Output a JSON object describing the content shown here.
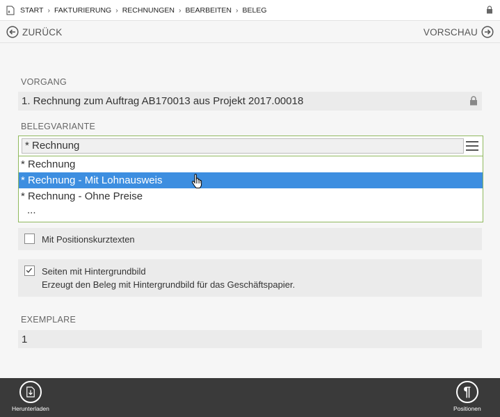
{
  "breadcrumb": {
    "items": [
      "START",
      "FAKTURIERUNG",
      "RECHNUNGEN",
      "BEARBEITEN",
      "BELEG"
    ],
    "separator": "›"
  },
  "nav": {
    "back_label": "ZURÜCK",
    "preview_label": "VORSCHAU"
  },
  "vorgang": {
    "label": "VORGANG",
    "value": "1. Rechnung zum Auftrag AB170013 aus Projekt 2017.00018",
    "locked": true
  },
  "belegvariante": {
    "label": "BELEGVARIANTE",
    "value": "* Rechnung",
    "options": [
      "* Rechnung",
      "* Rechnung - Mit Lohnausweis",
      "* Rechnung - Ohne Preise",
      "..."
    ],
    "highlighted_index": 1
  },
  "options": {
    "positionskurztexte_label": "Mit Positionskurztexten",
    "positionskurztexte_checked": false,
    "hintergrundbild_label": "Seiten mit Hintergrundbild",
    "hintergrundbild_desc": "Erzeugt den Beleg mit Hintergrundbild für das Geschäftspapier.",
    "hintergrundbild_checked": true
  },
  "exemplare": {
    "label": "EXEMPLARE",
    "value": "1"
  },
  "bottom": {
    "download_label": "Herunterladen",
    "positions_label": "Positionen",
    "positions_glyph": "¶"
  },
  "colors": {
    "accent_green": "#8fb85d",
    "selected_blue": "#3d8ee0",
    "bottom_bar": "#3a3a3a"
  }
}
